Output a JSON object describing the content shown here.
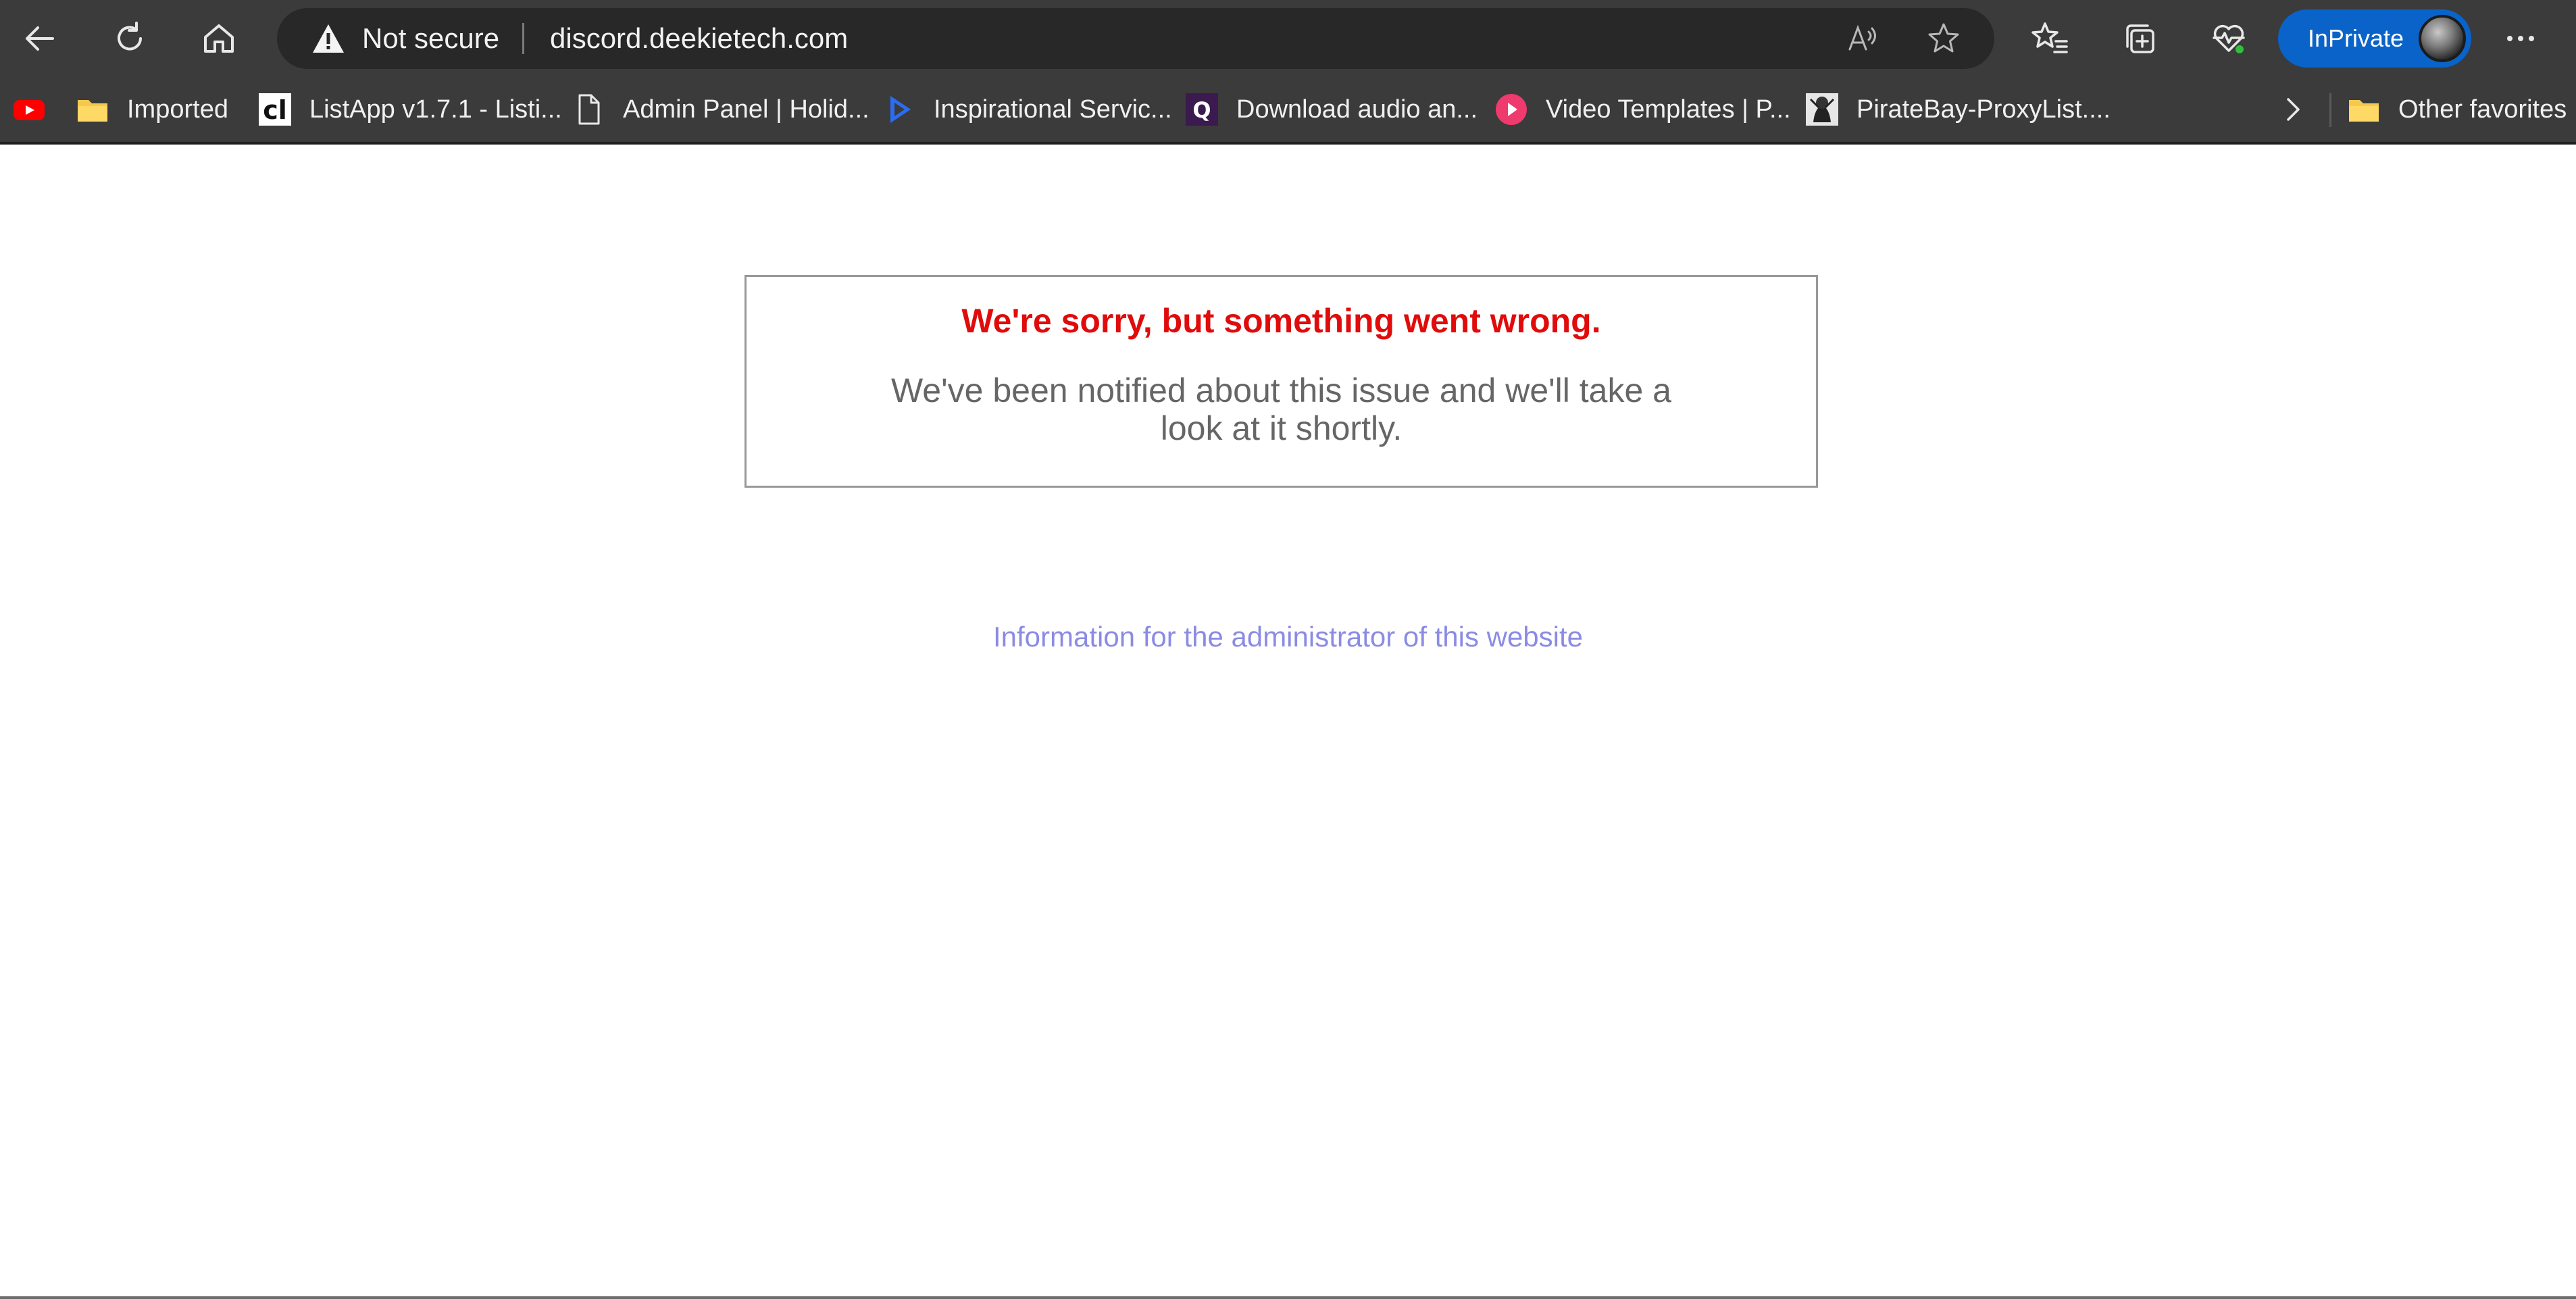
{
  "browser": {
    "address": {
      "security_label": "Not secure",
      "url": "discord.deekietech.com"
    },
    "inprivate_label": "InPrivate",
    "bookmarks": [
      {
        "label": "",
        "icon": "youtube-icon"
      },
      {
        "label": "Imported",
        "icon": "folder-icon"
      },
      {
        "label": "ListApp v1.7.1 - Listi...",
        "icon": "cl-logo-icon"
      },
      {
        "label": "Admin Panel | Holid...",
        "icon": "page-icon"
      },
      {
        "label": "Inspirational Servic...",
        "icon": "play-triangle-icon"
      },
      {
        "label": "Download audio an...",
        "icon": "q-logo-icon"
      },
      {
        "label": "Video Templates | P...",
        "icon": "pink-play-icon"
      },
      {
        "label": "PirateBay-ProxyList....",
        "icon": "pirate-icon"
      }
    ],
    "other_favorites": "Other favorites"
  },
  "page": {
    "error_title": "We're sorry, but something went wrong.",
    "error_line1": "We've been notified about this issue and we'll take a",
    "error_line2": "look at it shortly.",
    "admin_link": "Information for the administrator of this website"
  },
  "colors": {
    "error_title": "#e00b0b",
    "admin_link": "#8b8be5",
    "inprivate": "#0a63c9"
  }
}
